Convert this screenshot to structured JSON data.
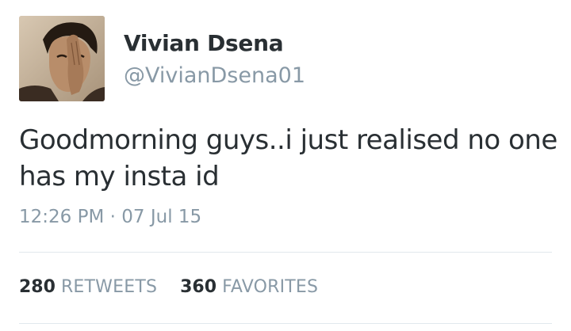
{
  "user": {
    "name": "Vivian Dsena",
    "handle": "@VivianDsena01"
  },
  "tweet": {
    "text": "Goodmorning guys..i just realised no one has my insta id",
    "time": "12:26 PM",
    "separator": "·",
    "date": "07 Jul 15"
  },
  "stats": {
    "retweets_count": "280",
    "retweets_label": "RETWEETS",
    "favorites_count": "360",
    "favorites_label": "FAVORITES"
  },
  "colors": {
    "text": "#292f33",
    "muted": "#8899a6",
    "divider": "#e1e8ed"
  }
}
